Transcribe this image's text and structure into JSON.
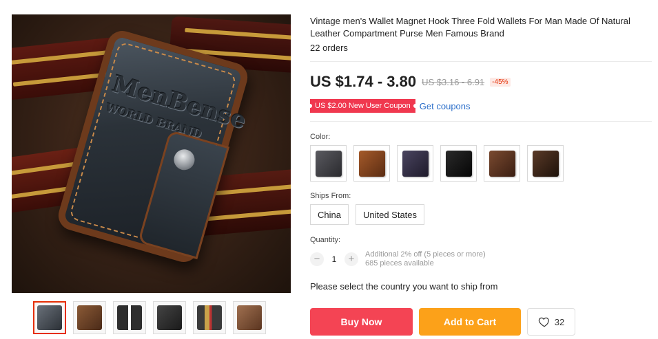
{
  "product": {
    "title": "Vintage men's Wallet Magnet Hook Three Fold Wallets For Man Made Of Natural Leather Compartment Purse Men Famous Brand",
    "orders": "22 orders",
    "main_image_text": [
      "MenBense",
      "WORLD BRAND"
    ],
    "thumbnails": [
      {
        "icon": "wallet-dark-gray-thumb",
        "color": "#4a5058",
        "active": true
      },
      {
        "icon": "wallet-brown-thumb",
        "color": "#6b4128",
        "active": false
      },
      {
        "icon": "wallet-open-black-thumb",
        "color": "#2e2e2e",
        "active": false
      },
      {
        "icon": "wallet-black-angle-thumb",
        "color": "#333333",
        "active": false
      },
      {
        "icon": "wallet-cards-thumb",
        "color": "#8a6a3a",
        "active": false
      },
      {
        "icon": "wallet-brown-open-thumb",
        "color": "#7a5030",
        "active": false
      }
    ]
  },
  "pricing": {
    "price": "US $1.74 - 3.80",
    "original_price": "US $3.16 - 6.91",
    "discount": "-45%",
    "coupon": "US $2.00 New User Coupon",
    "get_coupons": "Get coupons"
  },
  "options": {
    "color_label": "Color:",
    "colors": [
      {
        "icon": "dark-gray-wallet-swatch",
        "color": "#3b3a3e"
      },
      {
        "icon": "brown-wallet-swatch",
        "color": "#7a3f1e"
      },
      {
        "icon": "navy-wallet-swatch",
        "color": "#2e2a3a"
      },
      {
        "icon": "black-wallet-swatch",
        "color": "#141414"
      },
      {
        "icon": "coffee-wallet-swatch",
        "color": "#5a3222"
      },
      {
        "icon": "dark-brown-wallet-swatch",
        "color": "#3a2418"
      }
    ],
    "ships_from_label": "Ships From:",
    "ships_from": [
      "China",
      "United States"
    ],
    "quantity_label": "Quantity:",
    "quantity": "1",
    "qty_minus": "−",
    "qty_plus": "+",
    "qty_offer": "Additional 2% off (5 pieces or more)",
    "qty_available": "685 pieces available",
    "ship_note": "Please select the country you want to ship from"
  },
  "actions": {
    "buy_now": "Buy Now",
    "add_to_cart": "Add to Cart",
    "wishlist_count": "32"
  },
  "colors": {
    "accent": "#e62e04",
    "buy_now": "#f44454",
    "add_to_cart": "#fca119",
    "coupon": "#f0384f",
    "link": "#2b6ec9"
  }
}
